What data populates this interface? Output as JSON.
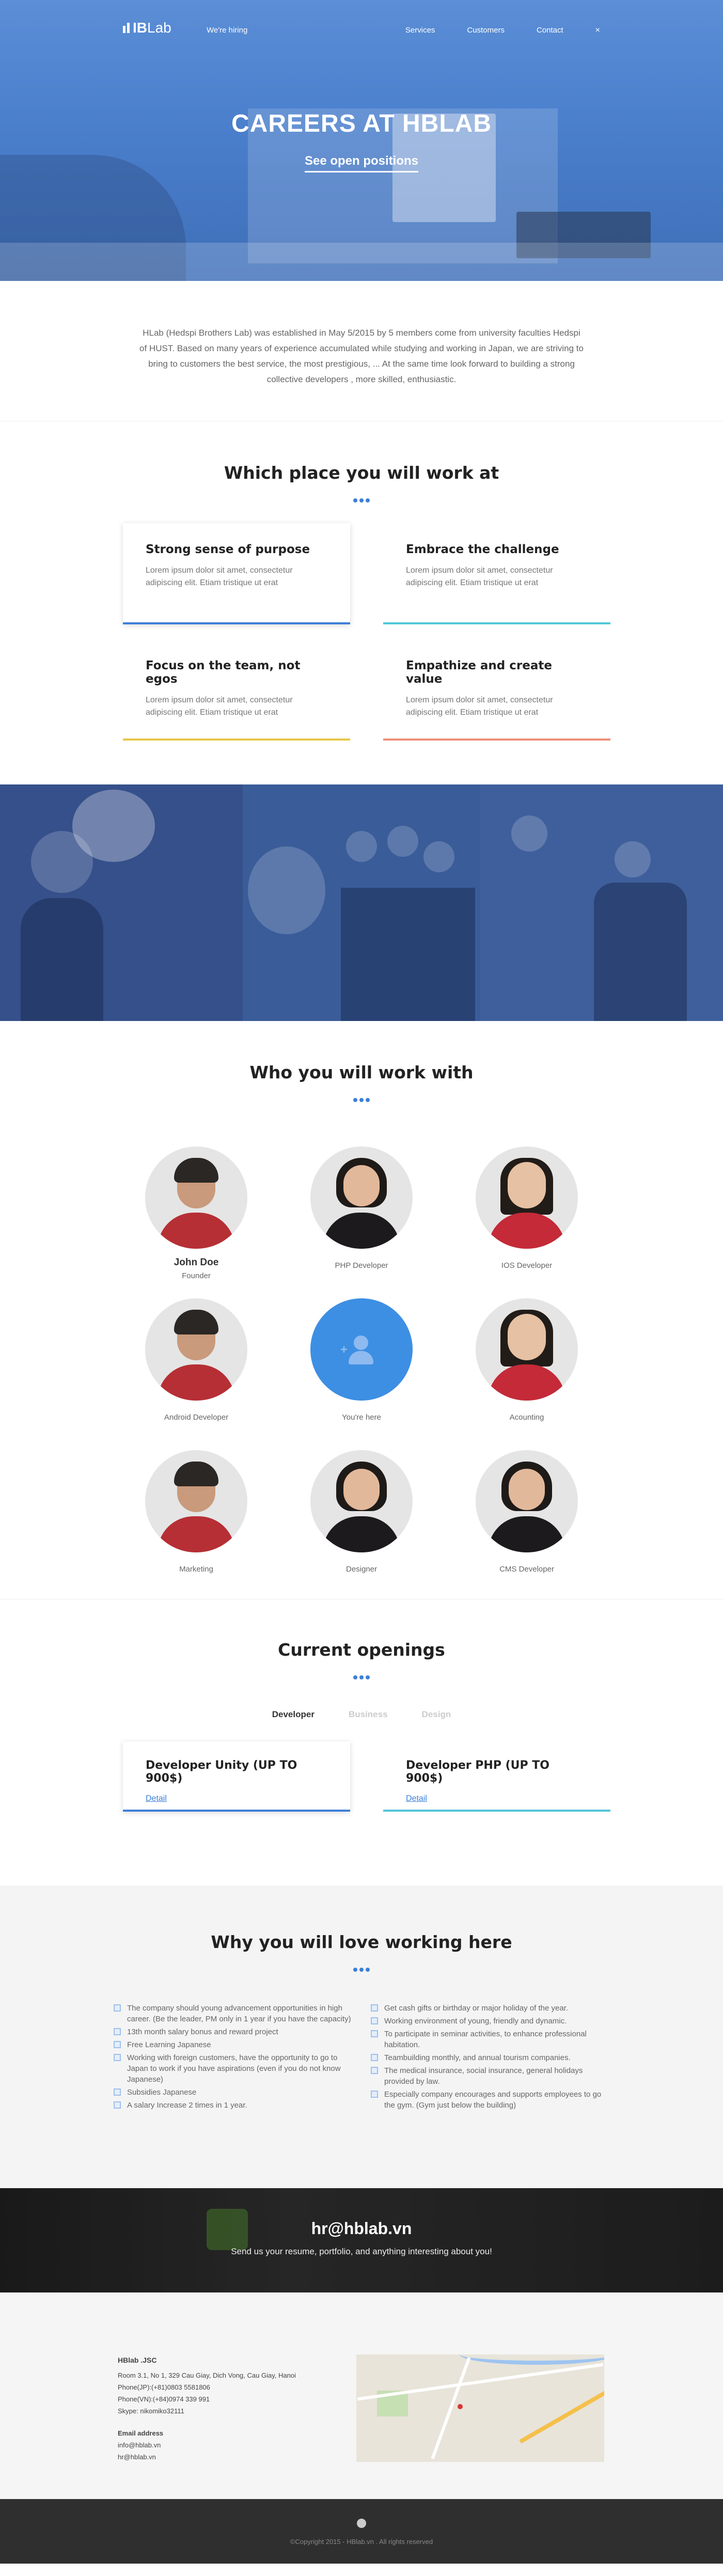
{
  "nav": {
    "logo": "Lab",
    "logo_prefix": "IB",
    "hiring": "We're hiring",
    "items": [
      "Services",
      "Customers",
      "Contact"
    ],
    "close": "×"
  },
  "hero": {
    "title": "CAREERS AT HBLAB",
    "cta": "See open positions"
  },
  "intro": {
    "text": "HLab (Hedspi Brothers Lab) was established in May 5/2015 by 5 members come from university faculties Hedspi of HUST. Based on many years of experience accumulated while studying and working in Japan, we are striving to bring to customers the best service, the most prestigious, ... At the same time look forward to building a strong collective developers , more skilled, enthusiastic."
  },
  "places": {
    "title": "Which place you will work at",
    "cards": [
      {
        "title": "Strong sense of purpose",
        "text": "Lorem ipsum dolor sit amet, consectetur adipiscing elit. Etiam tristique ut erat",
        "color": "#3d7fd9"
      },
      {
        "title": "Embrace the challenge",
        "text": "Lorem ipsum dolor sit amet, consectetur adipiscing elit. Etiam tristique ut erat",
        "color": "#4fc6d8"
      },
      {
        "title": "Focus on the team, not egos",
        "text": "Lorem ipsum dolor sit amet, consectetur adipiscing elit. Etiam tristique ut erat",
        "color": "#e6c94a"
      },
      {
        "title": "Empathize and create value",
        "text": "Lorem ipsum dolor sit amet, consectetur adipiscing elit. Etiam tristique ut erat",
        "color": "#ef8f7a"
      }
    ]
  },
  "team": {
    "title": "Who you will work with",
    "members": [
      {
        "name": "John Doe",
        "role": "Founder"
      },
      {
        "name": "",
        "role": "PHP Developer"
      },
      {
        "name": "",
        "role": "IOS Developer"
      },
      {
        "name": "",
        "role": "Android Developer"
      },
      {
        "name": "",
        "role": "You're here"
      },
      {
        "name": "",
        "role": "Acounting"
      },
      {
        "name": "",
        "role": "Marketing"
      },
      {
        "name": "",
        "role": "Designer"
      },
      {
        "name": "",
        "role": "CMS Developer"
      }
    ]
  },
  "openings": {
    "title": "Current openings",
    "tabs": [
      "Developer",
      "Business",
      "Design"
    ],
    "jobs": [
      {
        "title": "Developer Unity (UP TO 900$)",
        "link": "Detail",
        "color": "#3d7fd9"
      },
      {
        "title": "Developer PHP (UP TO 900$)",
        "link": "Detail",
        "color": "#4fc6d8"
      }
    ]
  },
  "why": {
    "title": "Why you will love working here",
    "left": [
      "The company should young advancement opportunities in high career. (Be the leader, PM only in 1 year if you have the capacity)",
      "13th month salary bonus and reward project",
      "Free Learning Japanese",
      "Working with foreign customers, have the opportunity to go to Japan to work if you have aspirations (even if you do not know Japanese)",
      "Subsidies Japanese",
      "A salary Increase 2 times in 1 year."
    ],
    "right": [
      "Get cash gifts or birthday or major holiday of the year.",
      "Working environment of young, friendly and dynamic.",
      "To participate in seminar activities, to enhance professional habitation.",
      "Teambuilding monthly, and annual tourism companies.",
      "The medical insurance, social insurance, general holidays provided by law.",
      "Especially company encourages and supports employees to go the gym. (Gym just below the building)"
    ]
  },
  "contact": {
    "email": "hr@hblab.vn",
    "text": "Send us your resume, portfolio, and anything interesting about you!"
  },
  "footer": {
    "company": "HBlab .JSC",
    "address": "Room 3.1, No 1, 329 Cau Giay, Dich Vong, Cau Giay, Hanoi",
    "phone_jp": "Phone(JP):(+81)0803 5581806",
    "phone_vn": "Phone(VN):(+84)0974 339 991",
    "skype": "Skype: nikomiko32111",
    "email_heading": "Email address",
    "email1": "info@hblab.vn",
    "email2": "hr@hblab.vn",
    "copyright": "©Copyright 2015 - HBlab.vn . All rights reserved"
  }
}
